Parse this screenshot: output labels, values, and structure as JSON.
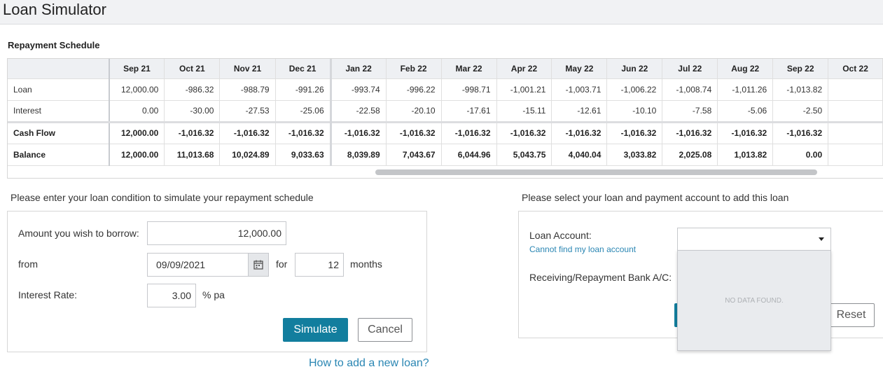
{
  "app": {
    "title": "Loan Simulator"
  },
  "schedule": {
    "title": "Repayment Schedule",
    "months": [
      "Sep 21",
      "Oct 21",
      "Nov 21",
      "Dec 21",
      "Jan 22",
      "Feb 22",
      "Mar 22",
      "Apr 22",
      "May 22",
      "Jun 22",
      "Jul 22",
      "Aug 22",
      "Sep 22",
      "Oct 22"
    ],
    "rows": [
      {
        "label": "Loan",
        "values": [
          "12,000.00",
          "-986.32",
          "-988.79",
          "-991.26",
          "-993.74",
          "-996.22",
          "-998.71",
          "-1,001.21",
          "-1,003.71",
          "-1,006.22",
          "-1,008.74",
          "-1,011.26",
          "-1,013.82",
          ""
        ]
      },
      {
        "label": "Interest",
        "values": [
          "0.00",
          "-30.00",
          "-27.53",
          "-25.06",
          "-22.58",
          "-20.10",
          "-17.61",
          "-15.11",
          "-12.61",
          "-10.10",
          "-7.58",
          "-5.06",
          "-2.50",
          ""
        ]
      },
      {
        "label": "Cash Flow",
        "values": [
          "12,000.00",
          "-1,016.32",
          "-1,016.32",
          "-1,016.32",
          "-1,016.32",
          "-1,016.32",
          "-1,016.32",
          "-1,016.32",
          "-1,016.32",
          "-1,016.32",
          "-1,016.32",
          "-1,016.32",
          "-1,016.32",
          ""
        ]
      },
      {
        "label": "Balance",
        "values": [
          "12,000.00",
          "11,013.68",
          "10,024.89",
          "9,033.63",
          "8,039.89",
          "7,043.67",
          "6,044.96",
          "5,043.75",
          "4,040.04",
          "3,033.82",
          "2,025.08",
          "1,013.82",
          "0.00",
          ""
        ]
      }
    ]
  },
  "simulate_form": {
    "title": "Please enter your loan condition to simulate your repayment schedule",
    "amount_label": "Amount you wish to borrow:",
    "amount_value": "12,000.00",
    "from_label": "from",
    "date_value": "09/09/2021",
    "for_label": "for",
    "months_value": "12",
    "months_label": "months",
    "rate_label": "Interest Rate:",
    "rate_value": "3.00",
    "rate_unit": "% pa",
    "simulate_label": "Simulate",
    "cancel_label": "Cancel",
    "help_link": "How to add a new loan?"
  },
  "add_loan_form": {
    "title": "Please select your loan and payment account to add this loan",
    "loan_account_label": "Loan Account:",
    "cannot_find_link": "Cannot find my loan account",
    "bank_label": "Receiving/Repayment Bank A/C:",
    "dropdown_empty": "NO DATA FOUND.",
    "reset_label": "Reset"
  },
  "colors": {
    "primary": "#127e9e",
    "link": "#2a86b3",
    "header_bg": "#f1f2f4"
  },
  "icons": {
    "calendar": "calendar-icon",
    "caret": "chevron-down-icon"
  }
}
